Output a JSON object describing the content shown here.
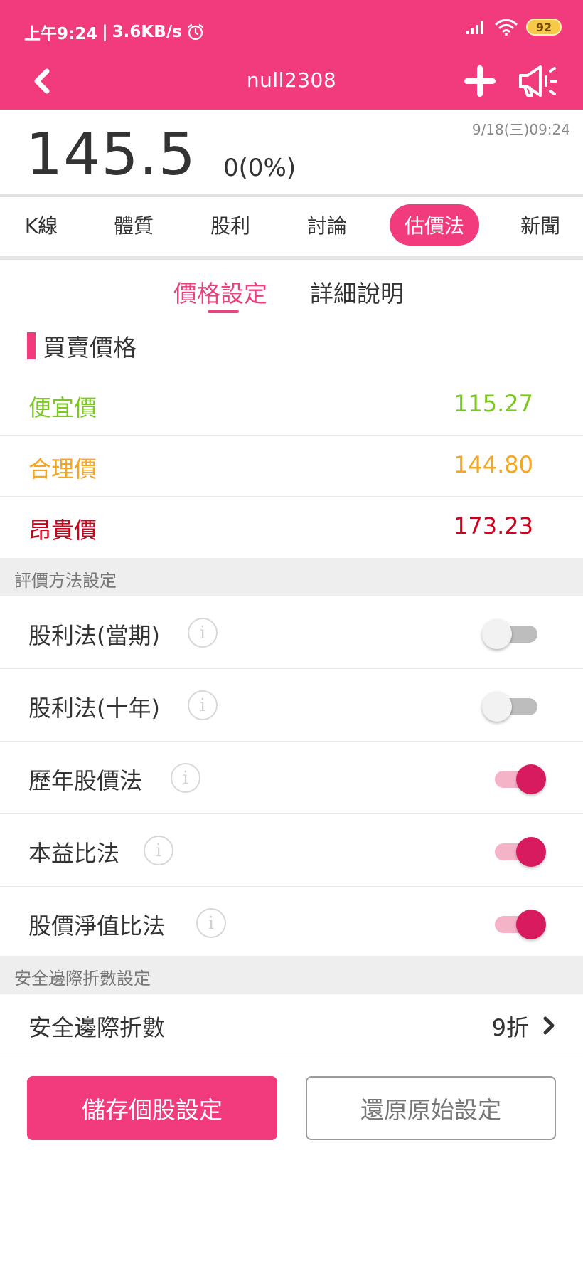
{
  "status_bar": {
    "time": "上午9:24",
    "speed": "3.6KB/s",
    "battery": "92"
  },
  "nav": {
    "title": "null2308"
  },
  "quote": {
    "price": "145.5",
    "change": "0(0%)",
    "datetime": "9/18(三)09:24"
  },
  "tabs": [
    {
      "label": "K線"
    },
    {
      "label": "體質"
    },
    {
      "label": "股利"
    },
    {
      "label": "討論"
    },
    {
      "label": "估價法"
    },
    {
      "label": "新聞"
    }
  ],
  "subtabs": [
    {
      "label": "價格設定"
    },
    {
      "label": "詳細說明"
    }
  ],
  "prices": {
    "heading": "買賣價格",
    "rows": [
      {
        "label": "便宜價",
        "value": "115.27",
        "color": "#7bc91e"
      },
      {
        "label": "合理價",
        "value": "144.80",
        "color": "#f5a623"
      },
      {
        "label": "昂貴價",
        "value": "173.23",
        "color": "#d0021b"
      }
    ]
  },
  "methods": {
    "heading": "評價方法設定",
    "items": [
      {
        "label": "股利法(當期)",
        "enabled": false
      },
      {
        "label": "股利法(十年)",
        "enabled": false
      },
      {
        "label": "歷年股價法",
        "enabled": true
      },
      {
        "label": "本益比法",
        "enabled": true
      },
      {
        "label": "股價淨值比法",
        "enabled": true
      }
    ]
  },
  "margin": {
    "heading": "安全邊際折數設定",
    "label": "安全邊際折數",
    "value": "9折"
  },
  "buttons": {
    "save": "儲存個股設定",
    "reset": "還原原始設定"
  },
  "colors": {
    "brand": "#f23b7c",
    "toggle_on": "#d81b5e"
  }
}
